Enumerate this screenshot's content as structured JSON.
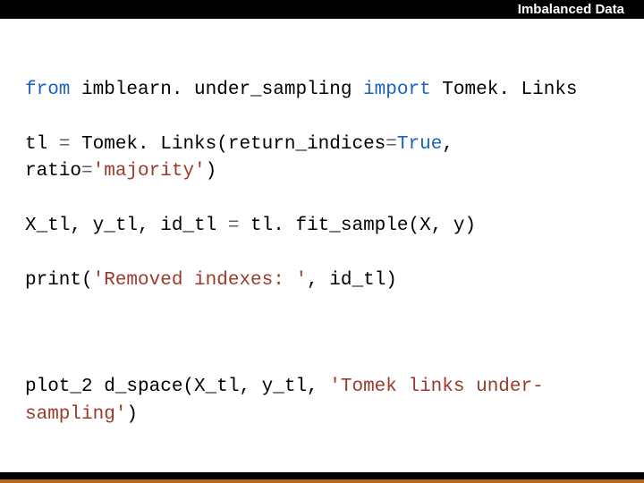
{
  "header": {
    "title": "Imbalanced Data"
  },
  "code": {
    "l1": {
      "kw_from": "from",
      "mod": " imblearn. under_sampling ",
      "kw_import": "import",
      "cls": " Tomek. Links"
    },
    "l2": {
      "a": "tl ",
      "eq": "=",
      "b": " Tomek. Links(return_indices",
      "eq2": "=",
      "lit": "True",
      "c": ", ratio",
      "eq3": "=",
      "str": "'majority'",
      "d": ")"
    },
    "l3": {
      "a": "X_tl, y_tl, id_tl ",
      "eq": "=",
      "b": " tl. fit_sample(X, y)"
    },
    "l4": {
      "a": "print(",
      "str": "'Removed indexes: '",
      "b": ", id_tl)"
    },
    "l5": {
      "a": "plot_2 d_space(X_tl, y_tl, ",
      "str": "'Tomek links under-sampling'",
      "b": ")"
    }
  }
}
